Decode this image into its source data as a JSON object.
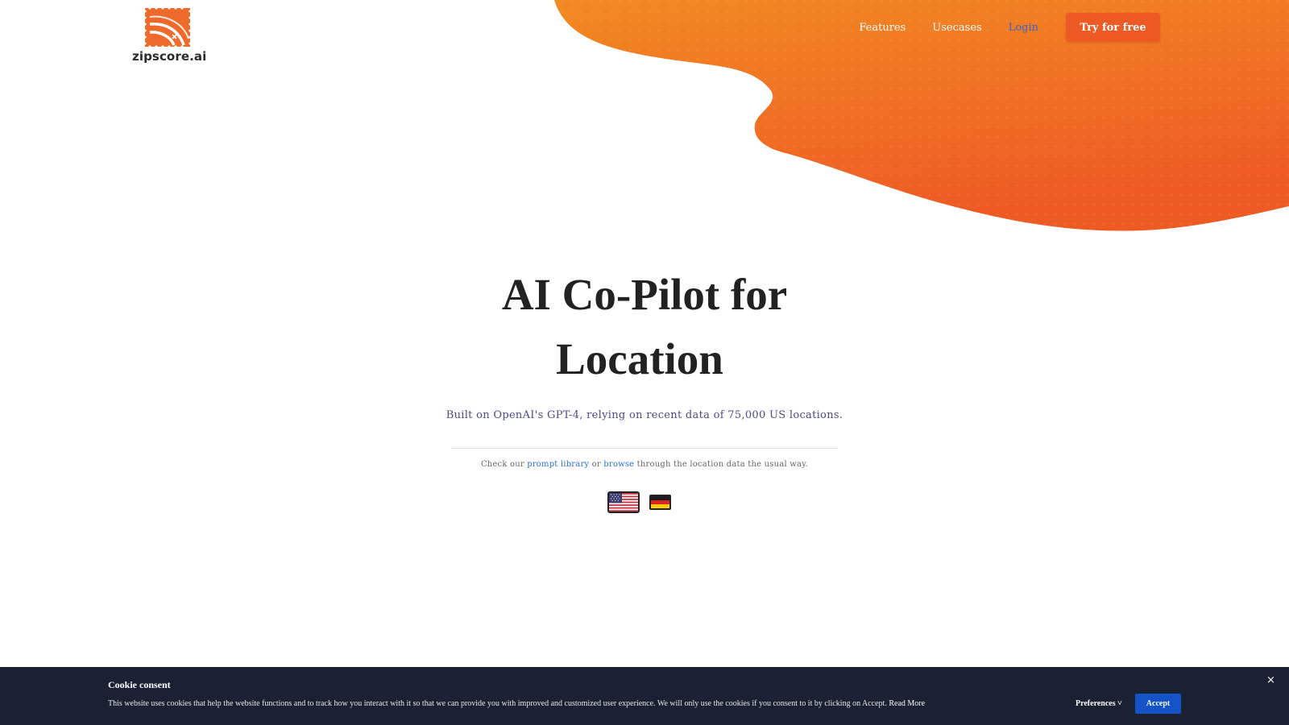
{
  "brand": {
    "name": "zipscore.ai",
    "logo_icon": "postage-stamp-route-icon",
    "accent": "#ee5a24"
  },
  "nav": {
    "features": "Features",
    "usecases": "Usecases",
    "login": "Login",
    "cta": "Try for free"
  },
  "hero": {
    "title_line1": "AI Co-Pilot for",
    "title_line2": "Location",
    "subtitle": "Built on OpenAI's GPT-4, relying on recent data of 75,000 US locations.",
    "helper_prefix": "Check our",
    "helper_link1": "prompt library",
    "helper_middle": "or",
    "helper_link2": "browse",
    "helper_suffix": "through the location data the usual way.",
    "flags": [
      "us-flag-icon",
      "de-flag-icon"
    ]
  },
  "cookie_banner": {
    "title": "Cookie consent",
    "text": "This website uses cookies that help the website functions and to track how you interact with it so that we can provide you with improved and customized user experience. We will only use the cookies if you consent to it by clicking on Accept.",
    "read_more": "Read More",
    "preferences": "Preferences",
    "preferences_caret": "˅",
    "accept": "Accept",
    "close": "×",
    "background": "#192133",
    "accept_color": "#1452c8"
  }
}
